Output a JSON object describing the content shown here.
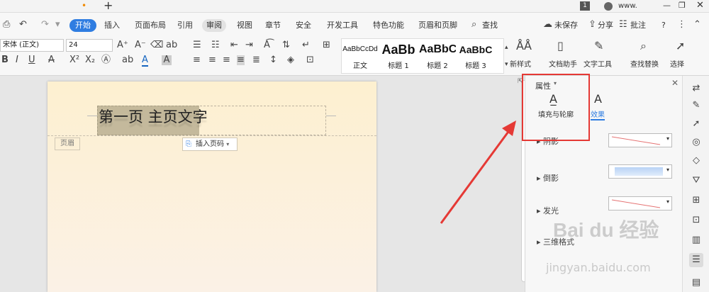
{
  "titlebar": {
    "page_badge": "1",
    "user_label": "www.",
    "tab_dot": "•",
    "add_tab": "+"
  },
  "tabs": [
    "开始",
    "插入",
    "页面布局",
    "引用",
    "审阅",
    "视图",
    "章节",
    "安全",
    "开发工具",
    "特色功能",
    "页眉和页脚",
    "查找"
  ],
  "right_tabs": {
    "unsaved": "未保存",
    "share": "分享",
    "comment": "批注",
    "help": "?"
  },
  "font": {
    "family": "宋体 (正文)",
    "size": "24"
  },
  "styles": [
    {
      "preview": "AaBbCcDd",
      "label": "正文"
    },
    {
      "preview": "AaBb",
      "label": "标题 1"
    },
    {
      "preview": "AaBbC",
      "label": "标题 2"
    },
    {
      "preview": "AaBbC",
      "label": "标题 3"
    }
  ],
  "ribbon_buttons": {
    "new_style": "新样式",
    "doc_helper": "文档助手",
    "text_tools": "文字工具",
    "find_replace": "查找替换",
    "select": "选择"
  },
  "document": {
    "header_text": "第一页  主页文字",
    "header_label": "页眉",
    "insert_page_number": "插入页码"
  },
  "panel": {
    "title": "属性",
    "tab_fill": "填充与轮廓",
    "tab_effect": "效果",
    "sections": [
      "阴影",
      "倒影",
      "发光",
      "三维格式"
    ]
  },
  "watermark": {
    "brand": "Bai du 经验",
    "url": "jingyan.baidu.com"
  },
  "colors": {
    "accent": "#2f7de1",
    "highlight_box": "#e53935",
    "arrow": "#e53935"
  }
}
